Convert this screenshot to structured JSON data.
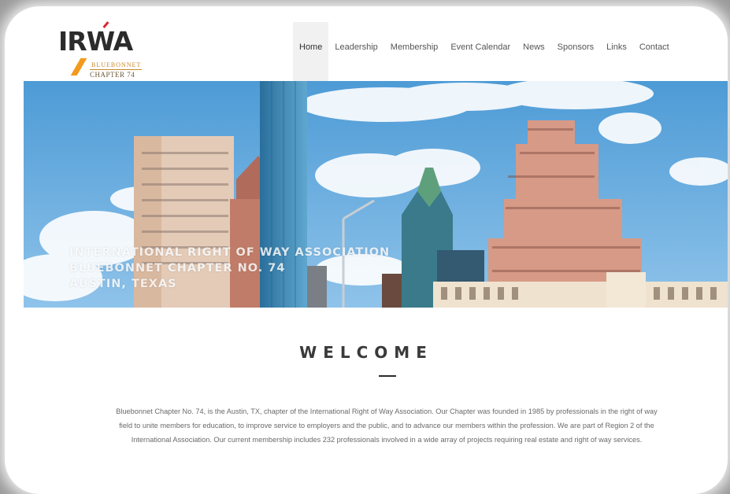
{
  "logo": {
    "mark": "IRWA",
    "sub1": "BLUEBONNET",
    "sub2": "CHAPTER 74"
  },
  "nav": {
    "items": [
      {
        "label": "Home",
        "active": true
      },
      {
        "label": "Leadership"
      },
      {
        "label": "Membership"
      },
      {
        "label": "Event Calendar"
      },
      {
        "label": "News"
      },
      {
        "label": "Sponsors"
      },
      {
        "label": "Links"
      },
      {
        "label": "Contact"
      }
    ]
  },
  "hero": {
    "line1": "INTERNATIONAL RIGHT OF WAY ASSOCIATION",
    "line2": "BLUEBONNET CHAPTER NO. 74",
    "line3": "AUSTIN, TEXAS"
  },
  "welcome": {
    "heading": "WELCOME",
    "body": "Bluebonnet Chapter No. 74, is the Austin, TX, chapter of the International Right of Way Association. Our Chapter was founded in 1985 by professionals in the right of way field to unite members for education, to improve service to employers and the public, and to advance our members within the profession. We are part of Region 2 of the International Association. Our current membership includes 232 professionals involved in a wide array of projects requiring real estate and right of way services."
  },
  "colors": {
    "logo_orange": "#f29a1e",
    "logo_red": "#d9282f",
    "sky": "#5fa8dc"
  }
}
